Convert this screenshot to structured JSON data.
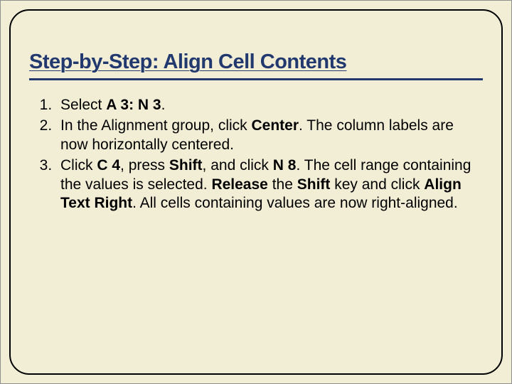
{
  "title": "Step-by-Step: Align Cell Contents",
  "steps": {
    "s1a": "Select ",
    "s1b": "A 3: N 3",
    "s1c": ".",
    "s2a": "In the Alignment group, click ",
    "s2b": "Center",
    "s2c": ". The column labels are now horizontally centered.",
    "s3a": "Click ",
    "s3b": "C 4",
    "s3c": ", press ",
    "s3d": "Shift",
    "s3e": ", and click ",
    "s3f": "N 8",
    "s3g": ". The cell range containing the values is selected. ",
    "s3h": "Release",
    "s3i": " the ",
    "s3j": "Shift",
    "s3k": " key and click ",
    "s3l": "Align Text Right",
    "s3m": ". All cells containing values are now right-aligned."
  }
}
